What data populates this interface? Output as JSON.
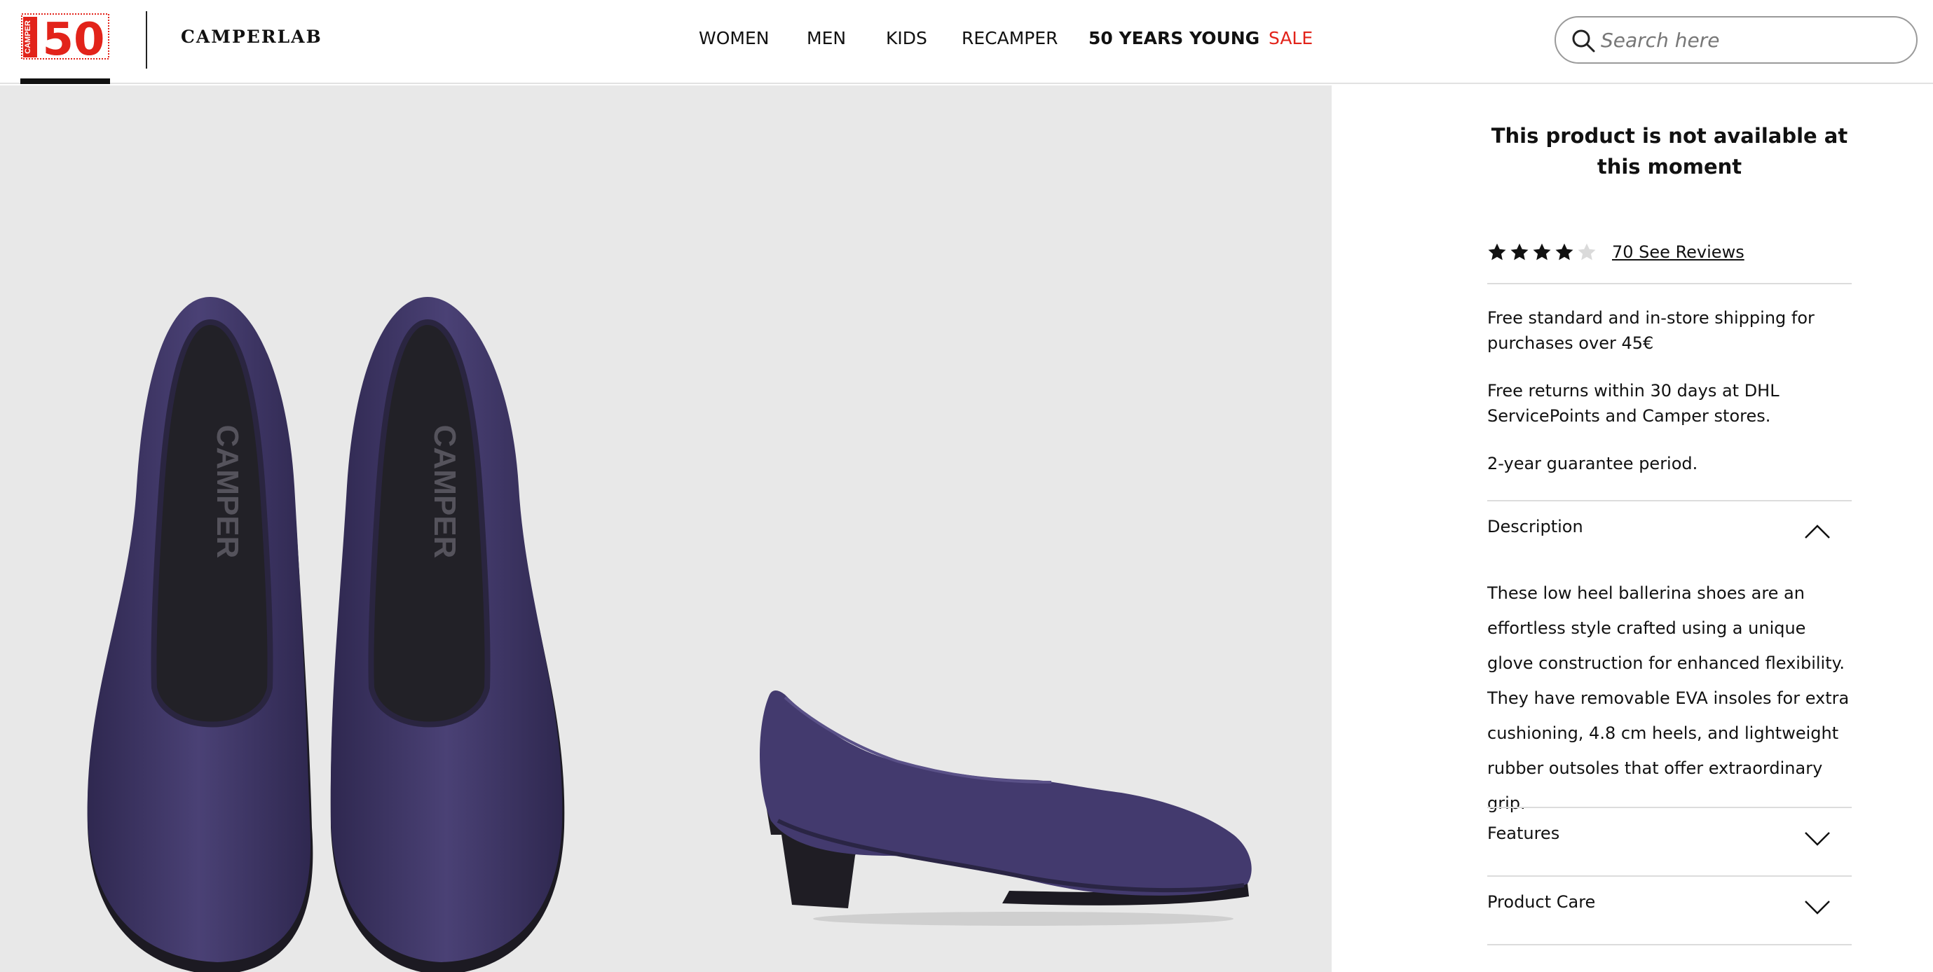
{
  "header": {
    "logo_text": "50",
    "logo_vertical_text": "CAMPER",
    "brand": "CAMPERLAB",
    "nav": [
      {
        "label": "WOMEN",
        "bold": false,
        "sale": false
      },
      {
        "label": "MEN",
        "bold": false,
        "sale": false
      },
      {
        "label": "KIDS",
        "bold": false,
        "sale": false
      },
      {
        "label": "RECAMPER",
        "bold": false,
        "sale": false
      },
      {
        "label": "50 YEARS YOUNG",
        "bold": true,
        "sale": false
      },
      {
        "label": "SALE",
        "bold": false,
        "sale": true
      }
    ],
    "search": {
      "placeholder": "Search here",
      "value": "",
      "icon": "search-icon"
    }
  },
  "gallery": {
    "insole_brand": "CAMPER",
    "shoe_color": "#3f3766",
    "background_color": "#e8e8e8"
  },
  "product": {
    "availability": "This product is not available at this moment",
    "rating": {
      "value": 4,
      "max": 5,
      "reviews_label": "70 See Reviews"
    },
    "shipping": [
      "Free standard and in-store shipping for purchases over 45€",
      "Free returns within 30 days at DHL ServicePoints and Camper stores.",
      "2-year guarantee period."
    ],
    "accordions": [
      {
        "title": "Description",
        "expanded": true,
        "icon": "chevron-up-icon"
      },
      {
        "title": "Features",
        "expanded": false,
        "icon": "chevron-down-icon"
      },
      {
        "title": "Product Care",
        "expanded": false,
        "icon": "chevron-down-icon"
      }
    ],
    "description": "These low heel ballerina shoes are an effortless style crafted using a unique glove construction for enhanced flexibility. They have removable EVA insoles for extra cushioning, 4.8 cm heels, and lightweight rubber outsoles that offer extraordinary grip."
  },
  "colors": {
    "accent_red": "#e2231a",
    "text": "#111111",
    "divider": "#dcdcdc"
  }
}
